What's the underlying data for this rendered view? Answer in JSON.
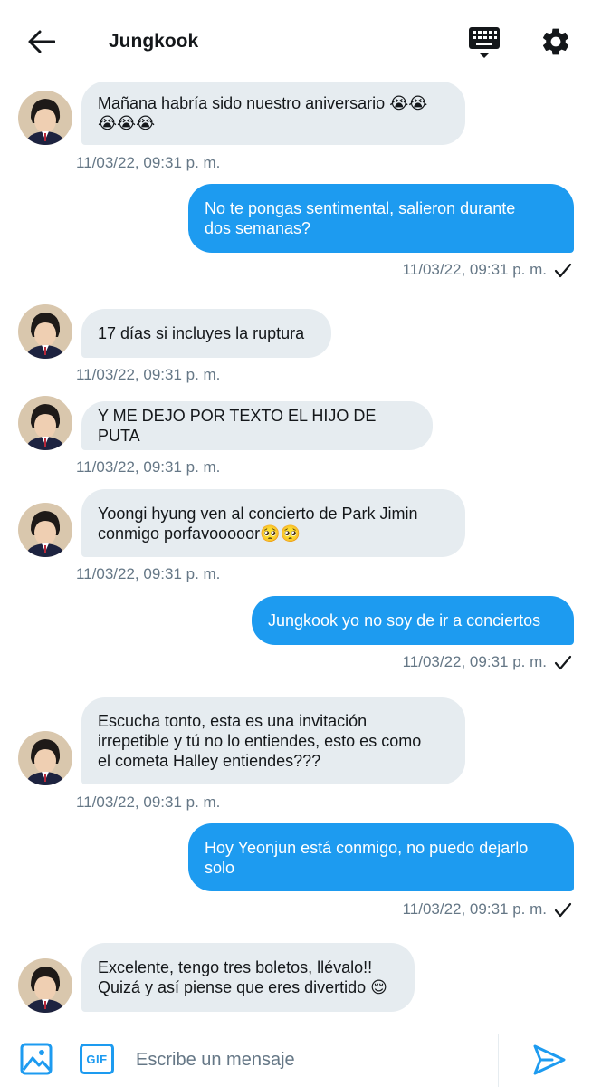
{
  "header": {
    "title": "Jungkook",
    "back_icon": "arrow-left-icon",
    "keyboard_icon": "keyboard-icon",
    "settings_icon": "gear-icon"
  },
  "colors": {
    "accent": "#1d9bf0",
    "incoming_bubble": "#e6ecf0",
    "timestamp": "#657786"
  },
  "messages": [
    {
      "direction": "in",
      "text": "Mañana habría sido nuestro aniversario 😭😭\n😭😭😭",
      "time": "11/03/22, 09:31 p. m."
    },
    {
      "direction": "out",
      "text": "No te pongas sentimental, salieron durante\ndos semanas?",
      "time": "11/03/22, 09:31 p. m."
    },
    {
      "direction": "in",
      "text": "17 días si incluyes la ruptura",
      "time": "11/03/22, 09:31 p. m."
    },
    {
      "direction": "in",
      "text": "Y ME DEJO POR TEXTO EL HIJO DE PUTA",
      "time": "11/03/22, 09:31 p. m."
    },
    {
      "direction": "in",
      "text": "Yoongi hyung ven al concierto de Park Jimin\nconmigo porfavooooor🥺🥺",
      "time": "11/03/22, 09:31 p. m."
    },
    {
      "direction": "out",
      "text": "Jungkook yo no soy de ir a conciertos",
      "time": "11/03/22, 09:31 p. m."
    },
    {
      "direction": "in",
      "text": "Escucha tonto, esta es una invitación\nirrepetible y tú no lo entiendes, esto es como\nel cometa Halley entiendes???",
      "time": "11/03/22, 09:31 p. m."
    },
    {
      "direction": "out",
      "text": "Hoy Yeonjun está conmigo, no puedo dejarlo\nsolo",
      "time": "11/03/22, 09:31 p. m."
    },
    {
      "direction": "in",
      "text": "Excelente, tengo tres boletos, llévalo!!\nQuizá y así piense que eres divertido 😌",
      "time": ""
    }
  ],
  "composer": {
    "placeholder": "Escribe un mensaje",
    "image_icon": "image-icon",
    "gif_label": "GIF",
    "send_icon": "send-icon"
  }
}
